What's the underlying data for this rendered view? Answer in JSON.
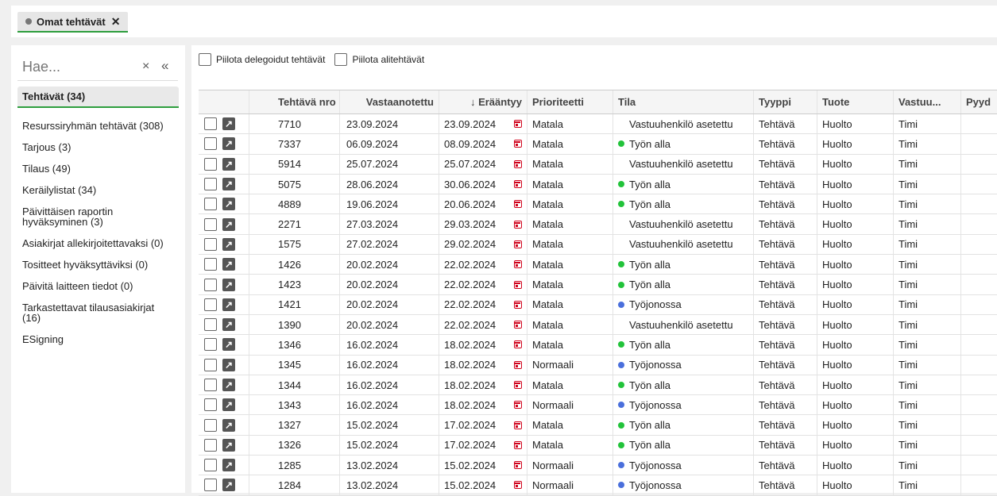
{
  "tabs": [
    {
      "label": "Omat tehtävät",
      "close": "✕"
    }
  ],
  "sidebar": {
    "search_placeholder": "Hae...",
    "clear": "×",
    "collapse": "«",
    "items": [
      {
        "label": "Tehtävät (34)",
        "active": true
      },
      {
        "label": "Resurssiryhmän tehtävät (308)"
      },
      {
        "label": "Tarjous (3)"
      },
      {
        "label": "Tilaus (49)"
      },
      {
        "label": "Keräilylistat (34)"
      },
      {
        "label": "Päivittäisen raportin hyväksyminen (3)"
      },
      {
        "label": "Asiakirjat allekirjoitettavaksi (0)"
      },
      {
        "label": "Tositteet hyväksyttäviksi (0)"
      },
      {
        "label": "Päivitä laitteen tiedot (0)"
      },
      {
        "label": "Tarkastettavat tilausasiakirjat (16)"
      },
      {
        "label": "ESigning"
      }
    ]
  },
  "filters": {
    "hide_delegated": "Piilota delegoidut tehtävät",
    "hide_subtasks": "Piilota alitehtävät"
  },
  "columns": {
    "nro": "Tehtävä nro",
    "received": "Vastaanotettu",
    "due": "↓ Erääntyy",
    "priority": "Prioriteetti",
    "status": "Tila",
    "type": "Tyyppi",
    "product": "Tuote",
    "owner": "Vastuu...",
    "extra": "Pyyd"
  },
  "colors": {
    "green": "#22c33a",
    "blue": "#4a6fdc",
    "accent": "#2e9e3e",
    "calendar": "#d0021b"
  },
  "rows": [
    {
      "nro": "7710",
      "received": "23.09.2024",
      "due": "23.09.2024",
      "priority": "Matala",
      "status": "Vastuuhenkilö asetettu",
      "dot": "none",
      "type": "Tehtävä",
      "product": "Huolto",
      "owner": "Timi"
    },
    {
      "nro": "7337",
      "received": "06.09.2024",
      "due": "08.09.2024",
      "priority": "Matala",
      "status": "Työn alla",
      "dot": "green",
      "type": "Tehtävä",
      "product": "Huolto",
      "owner": "Timi"
    },
    {
      "nro": "5914",
      "received": "25.07.2024",
      "due": "25.07.2024",
      "priority": "Matala",
      "status": "Vastuuhenkilö asetettu",
      "dot": "none",
      "type": "Tehtävä",
      "product": "Huolto",
      "owner": "Timi"
    },
    {
      "nro": "5075",
      "received": "28.06.2024",
      "due": "30.06.2024",
      "priority": "Matala",
      "status": "Työn alla",
      "dot": "green",
      "type": "Tehtävä",
      "product": "Huolto",
      "owner": "Timi"
    },
    {
      "nro": "4889",
      "received": "19.06.2024",
      "due": "20.06.2024",
      "priority": "Matala",
      "status": "Työn alla",
      "dot": "green",
      "type": "Tehtävä",
      "product": "Huolto",
      "owner": "Timi"
    },
    {
      "nro": "2271",
      "received": "27.03.2024",
      "due": "29.03.2024",
      "priority": "Matala",
      "status": "Vastuuhenkilö asetettu",
      "dot": "none",
      "type": "Tehtävä",
      "product": "Huolto",
      "owner": "Timi"
    },
    {
      "nro": "1575",
      "received": "27.02.2024",
      "due": "29.02.2024",
      "priority": "Matala",
      "status": "Vastuuhenkilö asetettu",
      "dot": "none",
      "type": "Tehtävä",
      "product": "Huolto",
      "owner": "Timi"
    },
    {
      "nro": "1426",
      "received": "20.02.2024",
      "due": "22.02.2024",
      "priority": "Matala",
      "status": "Työn alla",
      "dot": "green",
      "type": "Tehtävä",
      "product": "Huolto",
      "owner": "Timi"
    },
    {
      "nro": "1423",
      "received": "20.02.2024",
      "due": "22.02.2024",
      "priority": "Matala",
      "status": "Työn alla",
      "dot": "green",
      "type": "Tehtävä",
      "product": "Huolto",
      "owner": "Timi"
    },
    {
      "nro": "1421",
      "received": "20.02.2024",
      "due": "22.02.2024",
      "priority": "Matala",
      "status": "Työjonossa",
      "dot": "blue",
      "type": "Tehtävä",
      "product": "Huolto",
      "owner": "Timi"
    },
    {
      "nro": "1390",
      "received": "20.02.2024",
      "due": "22.02.2024",
      "priority": "Matala",
      "status": "Vastuuhenkilö asetettu",
      "dot": "none",
      "type": "Tehtävä",
      "product": "Huolto",
      "owner": "Timi"
    },
    {
      "nro": "1346",
      "received": "16.02.2024",
      "due": "18.02.2024",
      "priority": "Matala",
      "status": "Työn alla",
      "dot": "green",
      "type": "Tehtävä",
      "product": "Huolto",
      "owner": "Timi"
    },
    {
      "nro": "1345",
      "received": "16.02.2024",
      "due": "18.02.2024",
      "priority": "Normaali",
      "status": "Työjonossa",
      "dot": "blue",
      "type": "Tehtävä",
      "product": "Huolto",
      "owner": "Timi"
    },
    {
      "nro": "1344",
      "received": "16.02.2024",
      "due": "18.02.2024",
      "priority": "Matala",
      "status": "Työn alla",
      "dot": "green",
      "type": "Tehtävä",
      "product": "Huolto",
      "owner": "Timi"
    },
    {
      "nro": "1343",
      "received": "16.02.2024",
      "due": "18.02.2024",
      "priority": "Normaali",
      "status": "Työjonossa",
      "dot": "blue",
      "type": "Tehtävä",
      "product": "Huolto",
      "owner": "Timi"
    },
    {
      "nro": "1327",
      "received": "15.02.2024",
      "due": "17.02.2024",
      "priority": "Matala",
      "status": "Työn alla",
      "dot": "green",
      "type": "Tehtävä",
      "product": "Huolto",
      "owner": "Timi"
    },
    {
      "nro": "1326",
      "received": "15.02.2024",
      "due": "17.02.2024",
      "priority": "Matala",
      "status": "Työn alla",
      "dot": "green",
      "type": "Tehtävä",
      "product": "Huolto",
      "owner": "Timi"
    },
    {
      "nro": "1285",
      "received": "13.02.2024",
      "due": "15.02.2024",
      "priority": "Normaali",
      "status": "Työjonossa",
      "dot": "blue",
      "type": "Tehtävä",
      "product": "Huolto",
      "owner": "Timi"
    },
    {
      "nro": "1284",
      "received": "13.02.2024",
      "due": "15.02.2024",
      "priority": "Normaali",
      "status": "Työjonossa",
      "dot": "blue",
      "type": "Tehtävä",
      "product": "Huolto",
      "owner": "Timi"
    }
  ]
}
